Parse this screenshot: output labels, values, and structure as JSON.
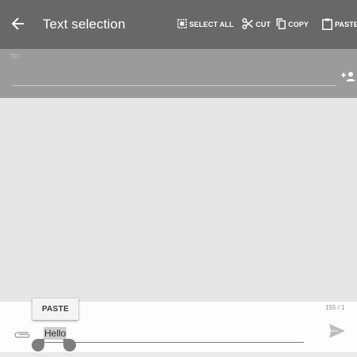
{
  "appbar": {
    "title": "Text selection",
    "back_icon": "arrow-left-icon",
    "actions": {
      "select_all": {
        "label": "SELECT ALL",
        "icon": "select-all-icon"
      },
      "cut": {
        "label": "CUT",
        "icon": "scissors-icon"
      },
      "copy": {
        "label": "COPY",
        "icon": "copy-icon"
      },
      "paste": {
        "label": "PASTE",
        "icon": "clipboard-icon"
      }
    }
  },
  "recipients": {
    "to_label": "TO",
    "add_icon": "add-person-icon"
  },
  "compose": {
    "paste_popup_label": "PASTE",
    "char_counter": "155 / 1",
    "message_text": "Hello",
    "attach_icon": "paperclip-icon",
    "send_icon": "send-icon"
  },
  "colors": {
    "appbar": "#686868",
    "recipients_bg": "#9b9b9b",
    "messages_bg": "#e6e6e6",
    "compose_bg": "#fdfdfd",
    "handles": "#7d7d7d"
  }
}
